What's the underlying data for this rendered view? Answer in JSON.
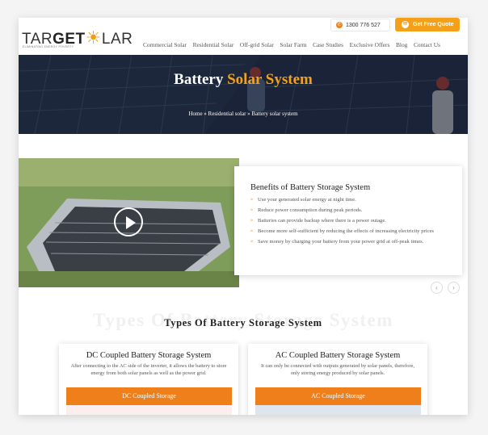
{
  "header": {
    "logo": {
      "word_start": "TAR",
      "word_get": "GET",
      "word_sun": "☀",
      "word_end": "LAR",
      "tagline": "ELIMINATING ENERGY POVERTY"
    },
    "phone": "1300 776 527",
    "quote_button": "Get Free Quote",
    "nav": [
      "Commercial Solar",
      "Residential Solar",
      "Off-grid Solar",
      "Solar Farm",
      "Case Studies",
      "Exclusive Offers",
      "Blog",
      "Contact Us"
    ]
  },
  "hero": {
    "title_plain": "Battery ",
    "title_highlight": "Solar System",
    "breadcrumb": "Home » Residential solar » Battery solar system"
  },
  "benefits": {
    "title": "Benefits of Battery Storage System",
    "items": [
      "Use your generated solar energy at night time.",
      "Reduce power consumption during peak periods.",
      "Batteries can provide backup where there is a power outage.",
      "Become more self-sufficient by reducing the effects of increasing electricity prices",
      "Save money by charging your battery from your power grid at off-peak times."
    ]
  },
  "slider": {
    "prev": "‹",
    "next": "›"
  },
  "types": {
    "watermark": "Types Of Battery Storage System",
    "title": "Types Of Battery Storage System",
    "cards": [
      {
        "title": "DC Coupled Battery Storage System",
        "description": "After connecting to the AC side of the inverter, it allows the battery to store energy from both solar panels as well as the power grid.",
        "button": "DC Coupled Storage"
      },
      {
        "title": "AC Coupled Battery Storage System",
        "description": "It can only be connected with outputs generated by solar panels, therefore, only storing energy produced by solar panels.",
        "button": "AC Coupled Storage"
      }
    ]
  },
  "colors": {
    "accent": "#f4a01b",
    "orange_bar": "#ef7f1a",
    "hero_bg": "#2a3342"
  }
}
